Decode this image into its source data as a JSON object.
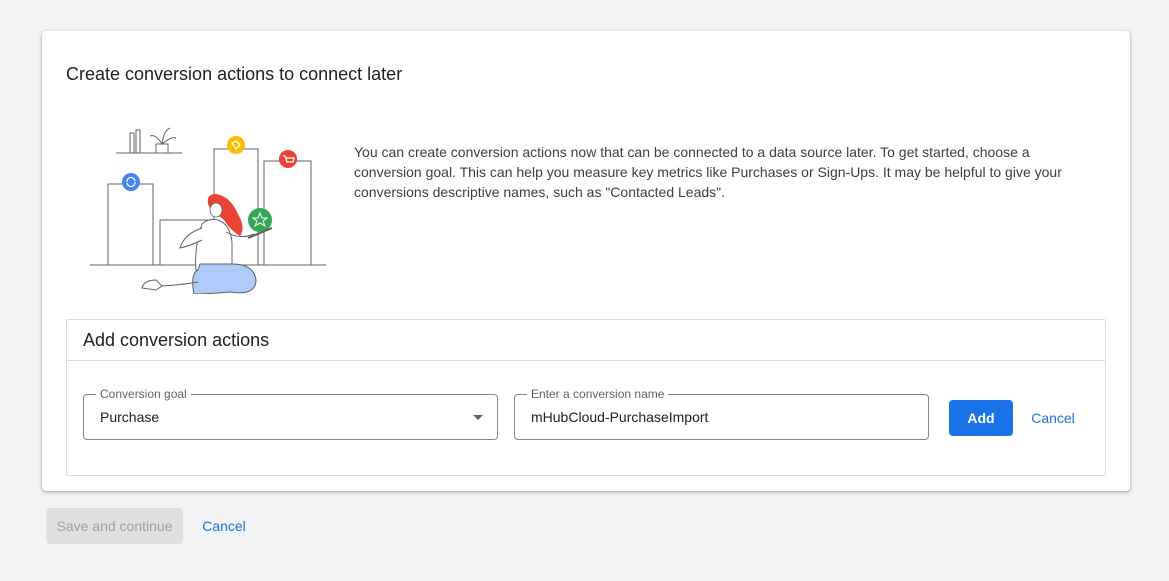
{
  "card": {
    "title": "Create conversion actions to connect later",
    "description": "You can create conversion actions now that can be connected to a data source later. To get started, choose a conversion goal. This can help you measure key metrics like Purchases or Sign-Ups. It may be helpful to give your conversions descriptive names, such as \"Contacted Leads\"."
  },
  "illustration": {
    "icons": [
      "refresh-icon",
      "tag-icon",
      "star-icon",
      "cart-icon",
      "plant-icon"
    ],
    "colors": {
      "blue": "#4285f4",
      "yellow": "#fbbc04",
      "green": "#34a853",
      "red": "#ea4335",
      "pants": "#aecbfa"
    }
  },
  "section": {
    "title": "Add conversion actions",
    "goal_field": {
      "label": "Conversion goal",
      "value": "Purchase"
    },
    "name_field": {
      "label": "Enter a conversion name",
      "value": "mHubCloud-PurchaseImport"
    },
    "add_label": "Add",
    "cancel_label": "Cancel"
  },
  "footer": {
    "save_label": "Save and continue",
    "cancel_label": "Cancel"
  },
  "colors": {
    "primary": "#1a73e8",
    "background": "#f1f3f4",
    "disabled_bg": "#e0e0e0",
    "disabled_text": "#9e9e9e"
  }
}
